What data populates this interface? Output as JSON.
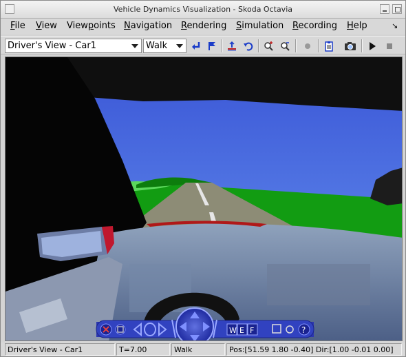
{
  "window": {
    "title": "Vehicle Dynamics Visualization - Skoda Octavia"
  },
  "menu": {
    "items": [
      {
        "label": "File",
        "mnemonic": "F"
      },
      {
        "label": "View",
        "mnemonic": "V"
      },
      {
        "label": "Viewpoints",
        "mnemonic": "p"
      },
      {
        "label": "Navigation",
        "mnemonic": "N"
      },
      {
        "label": "Rendering",
        "mnemonic": "R"
      },
      {
        "label": "Simulation",
        "mnemonic": "S"
      },
      {
        "label": "Recording",
        "mnemonic": "R"
      },
      {
        "label": "Help",
        "mnemonic": "H"
      }
    ]
  },
  "toolbar": {
    "viewpoint_select": "Driver's View - Car1",
    "navigation_select": "Walk",
    "icons": [
      "return-arrow-icon",
      "flag-icon",
      "level-icon",
      "undo-rotate-icon",
      "zoom-in-icon",
      "zoom-out-icon",
      "record-dot-icon",
      "clipboard-icon",
      "camera-icon",
      "play-icon",
      "stop-icon"
    ]
  },
  "status": {
    "viewpoint": "Driver's View - Car1",
    "time": "T=7.00",
    "mode": "Walk",
    "position": "Pos:[51.59 1.80 -0.40] Dir:[1.00 -0.01 0.00]"
  },
  "nav_overlay": {
    "labels": [
      "W",
      "E",
      "F"
    ]
  },
  "colors": {
    "sky": "#3f62d9",
    "grass": "#129c12",
    "road": "#8c8c76",
    "accent_nav": "#3344c6"
  }
}
